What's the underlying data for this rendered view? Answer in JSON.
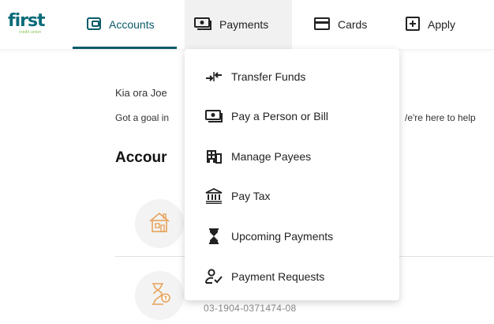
{
  "brand": {
    "word": "first",
    "sub": "credit union"
  },
  "nav": {
    "accounts": "Accounts",
    "payments": "Payments",
    "cards": "Cards",
    "apply": "Apply"
  },
  "main": {
    "greeting": "Kia ora Joe",
    "goal_text": "Got a goal in",
    "help_text": "/e're here to help",
    "section_title": "Accour",
    "account_number": "03-1904-0371474-08"
  },
  "payments_menu": {
    "items": [
      {
        "label": "Transfer Funds",
        "icon": "transfer-icon"
      },
      {
        "label": "Pay a Person or Bill",
        "icon": "cash-icon"
      },
      {
        "label": "Manage Payees",
        "icon": "building-icon"
      },
      {
        "label": "Pay Tax",
        "icon": "bank-icon"
      },
      {
        "label": "Upcoming Payments",
        "icon": "hourglass-icon"
      },
      {
        "label": "Payment Requests",
        "icon": "user-check-icon"
      }
    ]
  },
  "colors": {
    "brand": "#0b6b7a",
    "accent": "#7bbf3f",
    "active_nav": "#0b5b6a",
    "icon_orange": "#e8a25a"
  }
}
